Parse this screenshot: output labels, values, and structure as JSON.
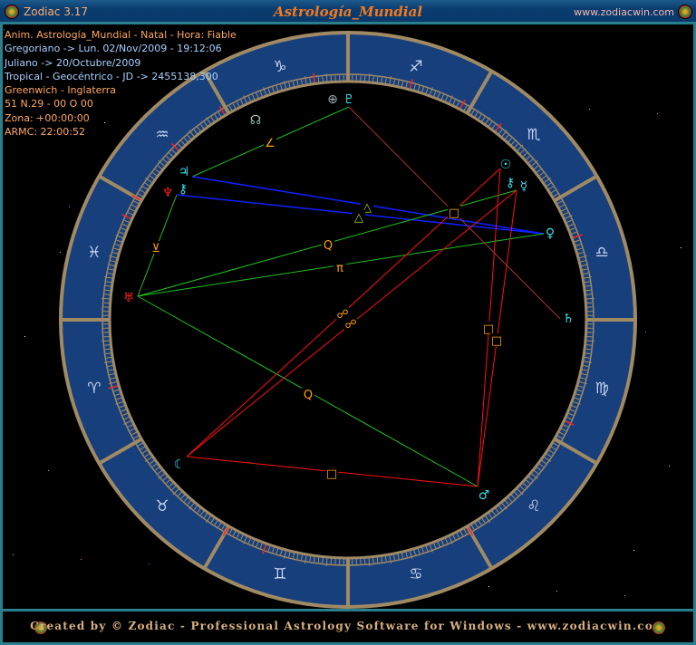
{
  "window": {
    "app_name": "Zodiac 3.17",
    "title": "Astrología_Mundial",
    "website": "www.zodiacwin.com"
  },
  "info": {
    "line1": "Anim. Astrología_Mundial - Natal - Hora: Fiable",
    "line2": "Gregoriano -> Lun. 02/Nov/2009 - 19:12:06",
    "line3": "Juliano -> 20/Octubre/2009",
    "line4": "Tropical - Geocéntrico - JD -> 2455138,300",
    "line5": "Greenwich - Inglaterra",
    "line6": "51 N.29 - 00 O 00",
    "line7": "Zona: +00:00:00",
    "line8": "ARMC: 22:00:52"
  },
  "signs": [
    "♑",
    "♒",
    "♓",
    "♈",
    "♉",
    "♊",
    "♋",
    "♌",
    "♍",
    "♎",
    "♏",
    "♐"
  ],
  "planets": {
    "pluto": {
      "glyph": "♇",
      "color": "#30e0f0"
    },
    "earth": {
      "glyph": "⊕",
      "color": "#a0b0b0"
    },
    "node": {
      "glyph": "☊",
      "color": "#a0c0b0"
    },
    "jupiter": {
      "glyph": "♃",
      "color": "#30e0f0"
    },
    "neptune": {
      "glyph": "♆",
      "color": "#ff2020"
    },
    "chiron_a": {
      "glyph": "⚷",
      "color": "#30e0f0"
    },
    "uranus": {
      "glyph": "♅",
      "color": "#ff2020"
    },
    "sun": {
      "glyph": "☉",
      "color": "#30e0f0"
    },
    "chiron_b": {
      "glyph": "⚷",
      "color": "#30e0f0"
    },
    "mercury": {
      "glyph": "☿",
      "color": "#30e0f0"
    },
    "venus": {
      "glyph": "♀",
      "color": "#30e0f0"
    },
    "saturn": {
      "glyph": "♄",
      "color": "#30e0f0"
    },
    "mars": {
      "glyph": "♂",
      "color": "#30e0f0"
    },
    "moon": {
      "glyph": "☾",
      "color": "#30e0f0"
    }
  },
  "aspects": [
    {
      "from": "jupiter",
      "to": "pluto",
      "symbol": "∠",
      "color": "#20c020"
    },
    {
      "from": "neptune",
      "to": "uranus",
      "symbol": "⊻",
      "color": "#20c020"
    },
    {
      "from": "jupiter",
      "to": "venus",
      "symbol": "△",
      "color": "#1020ff"
    },
    {
      "from": "neptune",
      "to": "venus",
      "symbol": "△",
      "color": "#1020ff"
    },
    {
      "from": "uranus",
      "to": "mercury",
      "symbol": "Q",
      "color": "#20c020"
    },
    {
      "from": "uranus",
      "to": "venus",
      "symbol": "π",
      "color": "#20c020"
    },
    {
      "from": "uranus",
      "to": "mars",
      "symbol": "Q",
      "color": "#20c020"
    },
    {
      "from": "moon",
      "to": "sun",
      "symbol": "☍",
      "color": "#ff1010"
    },
    {
      "from": "moon",
      "to": "mercury",
      "symbol": "☍",
      "color": "#ff1010"
    },
    {
      "from": "moon",
      "to": "mars",
      "symbol": "□",
      "color": "#ff1010"
    },
    {
      "from": "sun",
      "to": "mars",
      "symbol": "□",
      "color": "#ff1010"
    },
    {
      "from": "mercury",
      "to": "mars",
      "symbol": "□",
      "color": "#ff1010"
    },
    {
      "from": "pluto",
      "to": "saturn",
      "symbol": "□",
      "color": "#b03030"
    }
  ],
  "footer": {
    "text": "Created by © Zodiac - Professional Astrology Software for Windows - www.zodiacwin.com"
  },
  "colors": {
    "band": "#173f7c",
    "ring": "#a08a64",
    "frame": "#2a7f8f",
    "aspect_symbol": "#ffa000"
  }
}
